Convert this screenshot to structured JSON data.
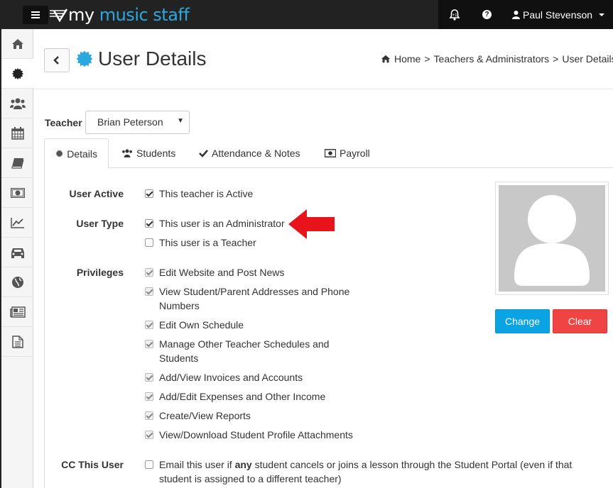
{
  "app": {
    "logo_prefix": "my ",
    "logo_brand": "music staff",
    "user_name": "Paul Stevenson"
  },
  "header": {
    "title": "User Details",
    "breadcrumb": [
      "Home",
      "Teachers & Administrators",
      "User Details"
    ]
  },
  "teacher": {
    "label": "Teacher",
    "selected": "Brian Peterson"
  },
  "tabs": [
    {
      "label": "Details",
      "icon": "gear-icon",
      "active": true
    },
    {
      "label": "Students",
      "icon": "users-icon",
      "active": false
    },
    {
      "label": "Attendance & Notes",
      "icon": "check-icon",
      "active": false
    },
    {
      "label": "Payroll",
      "icon": "money-icon",
      "active": false
    }
  ],
  "form": {
    "user_active": {
      "label": "User Active",
      "option": "This teacher is Active",
      "checked": true
    },
    "user_type": {
      "label": "User Type",
      "options": [
        {
          "text": "This user is an Administrator",
          "checked": true
        },
        {
          "text": "This user is a Teacher",
          "checked": false
        }
      ]
    },
    "privileges": {
      "label": "Privileges",
      "options": [
        {
          "line1": "Edit Website and Post News",
          "line2": ""
        },
        {
          "line1": "View Student/Parent Addresses and Phone",
          "line2": "Numbers"
        },
        {
          "line1": "Edit Own Schedule",
          "line2": ""
        },
        {
          "line1": "Manage Other Teacher Schedules and",
          "line2": "Students"
        },
        {
          "line1": "Add/View Invoices and Accounts",
          "line2": ""
        },
        {
          "line1": "Add/Edit Expenses and Other Income",
          "line2": ""
        },
        {
          "line1": "Create/View Reports",
          "line2": ""
        },
        {
          "line1": "View/Download Student Profile Attachments",
          "line2": ""
        }
      ]
    },
    "cc_user": {
      "label": "CC This User",
      "text_pre": "Email this user if ",
      "text_bold": "any",
      "text_post": " student cancels or joins a lesson through the Student Portal (even if that",
      "text_line2": "student is assigned to a different teacher)",
      "checked": false
    }
  },
  "photo": {
    "change_label": "Change",
    "clear_label": "Clear"
  },
  "colors": {
    "topbar": "#222222",
    "brand_blue": "#2ba8de",
    "change_button": "#0aa3e3",
    "clear_button": "#ef4444",
    "arrow": "#e8141c"
  },
  "sidebar_icons": [
    "home-icon",
    "gear-icon",
    "users-icon",
    "calendar-icon",
    "book-icon",
    "money-icon",
    "chart-icon",
    "car-icon",
    "globe-icon",
    "newspaper-icon",
    "document-icon"
  ]
}
